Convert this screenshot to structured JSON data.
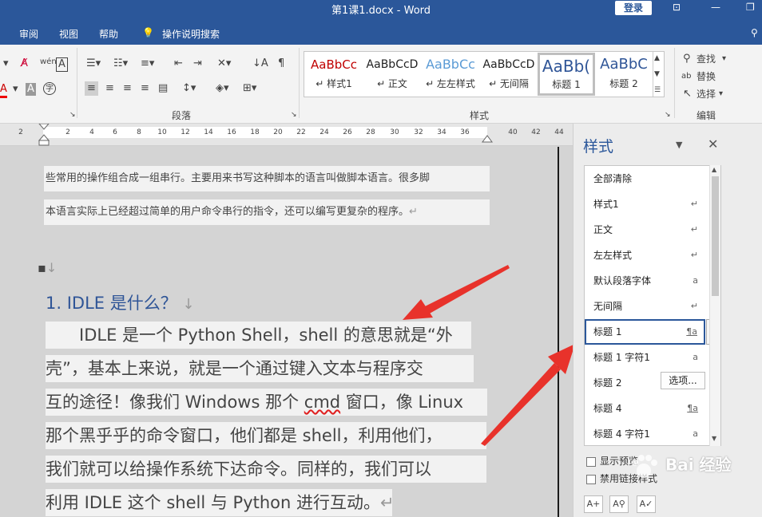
{
  "window": {
    "title": "第1课1.docx  -  Word",
    "login": "登录"
  },
  "menu": [
    "审阅",
    "视图",
    "帮助"
  ],
  "tell_me": "操作说明搜索",
  "ribbon": {
    "style_tiles": [
      {
        "sample": "AaBbCc",
        "name": "↵ 样式1",
        "color": "#c00000"
      },
      {
        "sample": "AaBbCcD",
        "name": "↵ 正文",
        "color": "#222222"
      },
      {
        "sample": "AaBbCc",
        "name": "↵ 左左样式",
        "color": "#5b9bd5"
      },
      {
        "sample": "AaBbCcD",
        "name": "↵ 无间隔",
        "color": "#222222"
      },
      {
        "sample": "AaBb(",
        "name": "标题 1",
        "color": "#2f5597"
      },
      {
        "sample": "AaBbC",
        "name": "标题 2",
        "color": "#2f5597"
      }
    ],
    "find": "查找",
    "replace": "替换",
    "select": "选择",
    "paragraph_label": "段落",
    "styles_label": "样式",
    "editing_label": "编辑"
  },
  "ruler": [
    "2",
    "2",
    "4",
    "6",
    "8",
    "10",
    "12",
    "14",
    "16",
    "18",
    "20",
    "22",
    "24",
    "26",
    "28",
    "30",
    "32",
    "34",
    "36",
    "40",
    "42",
    "44"
  ],
  "doc": {
    "line1": "些常用的操作组合成一组串行。主要用来书写这种脚本的语言叫做脚本语言。很多脚",
    "line2": "本语言实际上已经超过简单的用户命令串行的指令，还可以编写更复杂的程序。",
    "para_mark": "↵",
    "empty_mark": "↓",
    "heading": "1. IDLE  是什么？",
    "heading_mark": "↓",
    "body": [
      "　　IDLE 是一个 Python Shell，shell 的意思就是“外",
      "壳”，基本上来说，就是一个通过键入文本与程序交",
      "互的途径！像我们 Windows 那个 ",
      "那个黑乎乎的命令窗口，他们都是 shell，利用他们，",
      "我们就可以给操作系统下达命令。同样的，我们可以",
      "利用 IDLE 这个 shell 与 Python 进行互动。"
    ],
    "body3_word": "cmd",
    "body3_tail": " 窗口，像 Linux"
  },
  "pane": {
    "title": "样式",
    "items": [
      {
        "label": "全部清除",
        "symbol": ""
      },
      {
        "label": "样式1",
        "symbol": "↵"
      },
      {
        "label": "正文",
        "symbol": "↵"
      },
      {
        "label": "左左样式",
        "symbol": "↵"
      },
      {
        "label": "默认段落字体",
        "symbol": "a"
      },
      {
        "label": "无间隔",
        "symbol": "↵"
      },
      {
        "label": "标题 1",
        "symbol": "¶a"
      },
      {
        "label": "标题 1 字符1",
        "symbol": "a"
      },
      {
        "label": "标题 2",
        "symbol": "¶a"
      },
      {
        "label": "标题 4",
        "symbol": "¶a"
      },
      {
        "label": "标题 4 字符1",
        "symbol": "a"
      }
    ],
    "show_preview": "显示预览",
    "disable_linked": "禁用链接样式",
    "options": "选项..."
  },
  "watermark": "Bai 经验",
  "colors": {
    "accent": "#2b579a",
    "arrow": "#e8322b",
    "heading": "#2f5597"
  }
}
